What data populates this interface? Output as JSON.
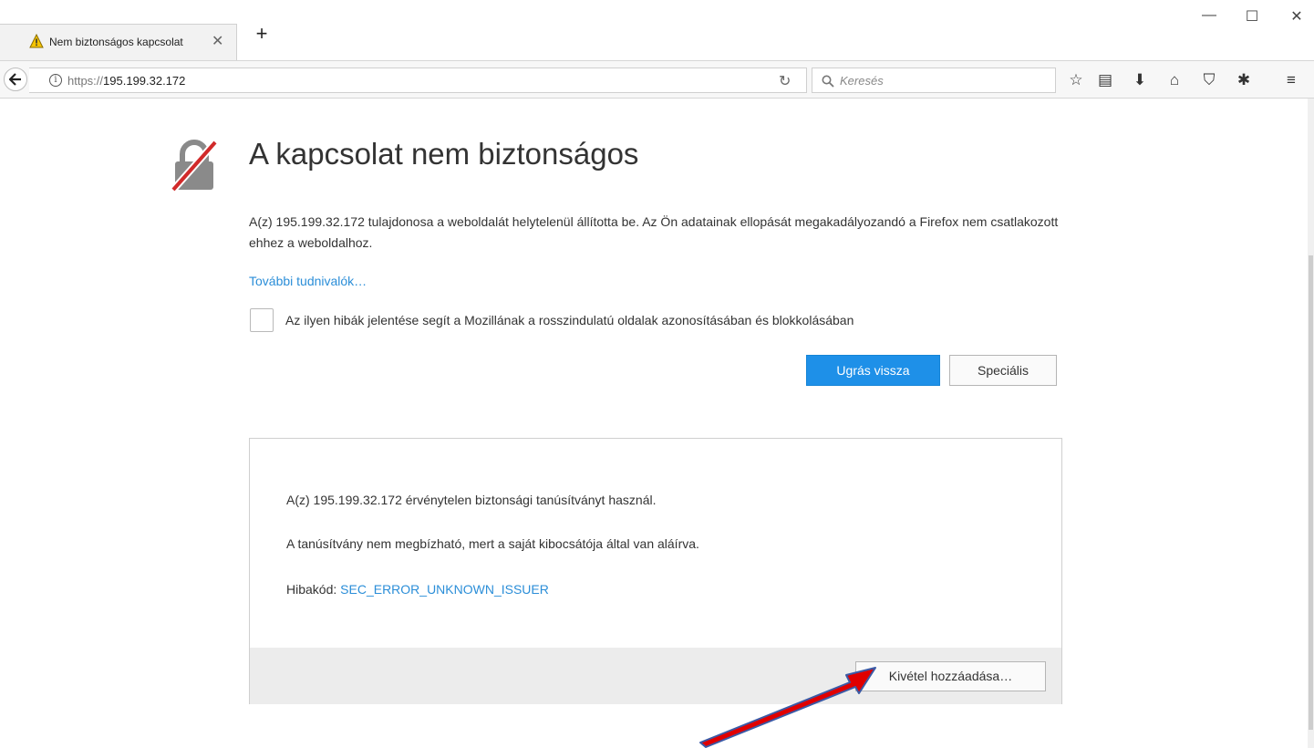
{
  "tab": {
    "title": "Nem biztonságos kapcsolat",
    "close": "✕",
    "new_tab": "+"
  },
  "window": {
    "minimize": "—",
    "maximize": "☐",
    "close": "✕"
  },
  "navbar": {
    "url_scheme": "https://",
    "url_host": "195.199.32.172",
    "info": "i",
    "reload": "↻",
    "search_placeholder": "Keresés",
    "tools": [
      "☆",
      "▤",
      "⬇",
      "⌂",
      "⛉",
      "✱",
      "≡"
    ]
  },
  "page": {
    "title": "A kapcsolat nem biztonságos",
    "description": "A(z) 195.199.32.172 tulajdonosa a weboldalát helytelenül állította be. Az Ön adatainak ellopását megakadályozandó a Firefox nem csatlakozott ehhez a weboldalhoz.",
    "learn_more": "További tudnivalók…",
    "report_label": "Az ilyen hibák jelentése segít a Mozillának a rosszindulatú oldalak azonosításában és blokkolásában",
    "go_back_button": "Ugrás vissza",
    "advanced_button": "Speciális"
  },
  "advanced": {
    "line1": "A(z) 195.199.32.172 érvénytelen biztonsági tanúsítványt használ.",
    "line2": "A tanúsítvány nem megbízható, mert a saját kibocsátója által van aláírva.",
    "error_label": "Hibakód:",
    "error_code": "SEC_ERROR_UNKNOWN_ISSUER",
    "add_exception_button": "Kivétel hozzáadása…"
  },
  "colors": {
    "accent": "#1e90e8",
    "link": "#2b8ed8",
    "arrow": "#e00000"
  }
}
